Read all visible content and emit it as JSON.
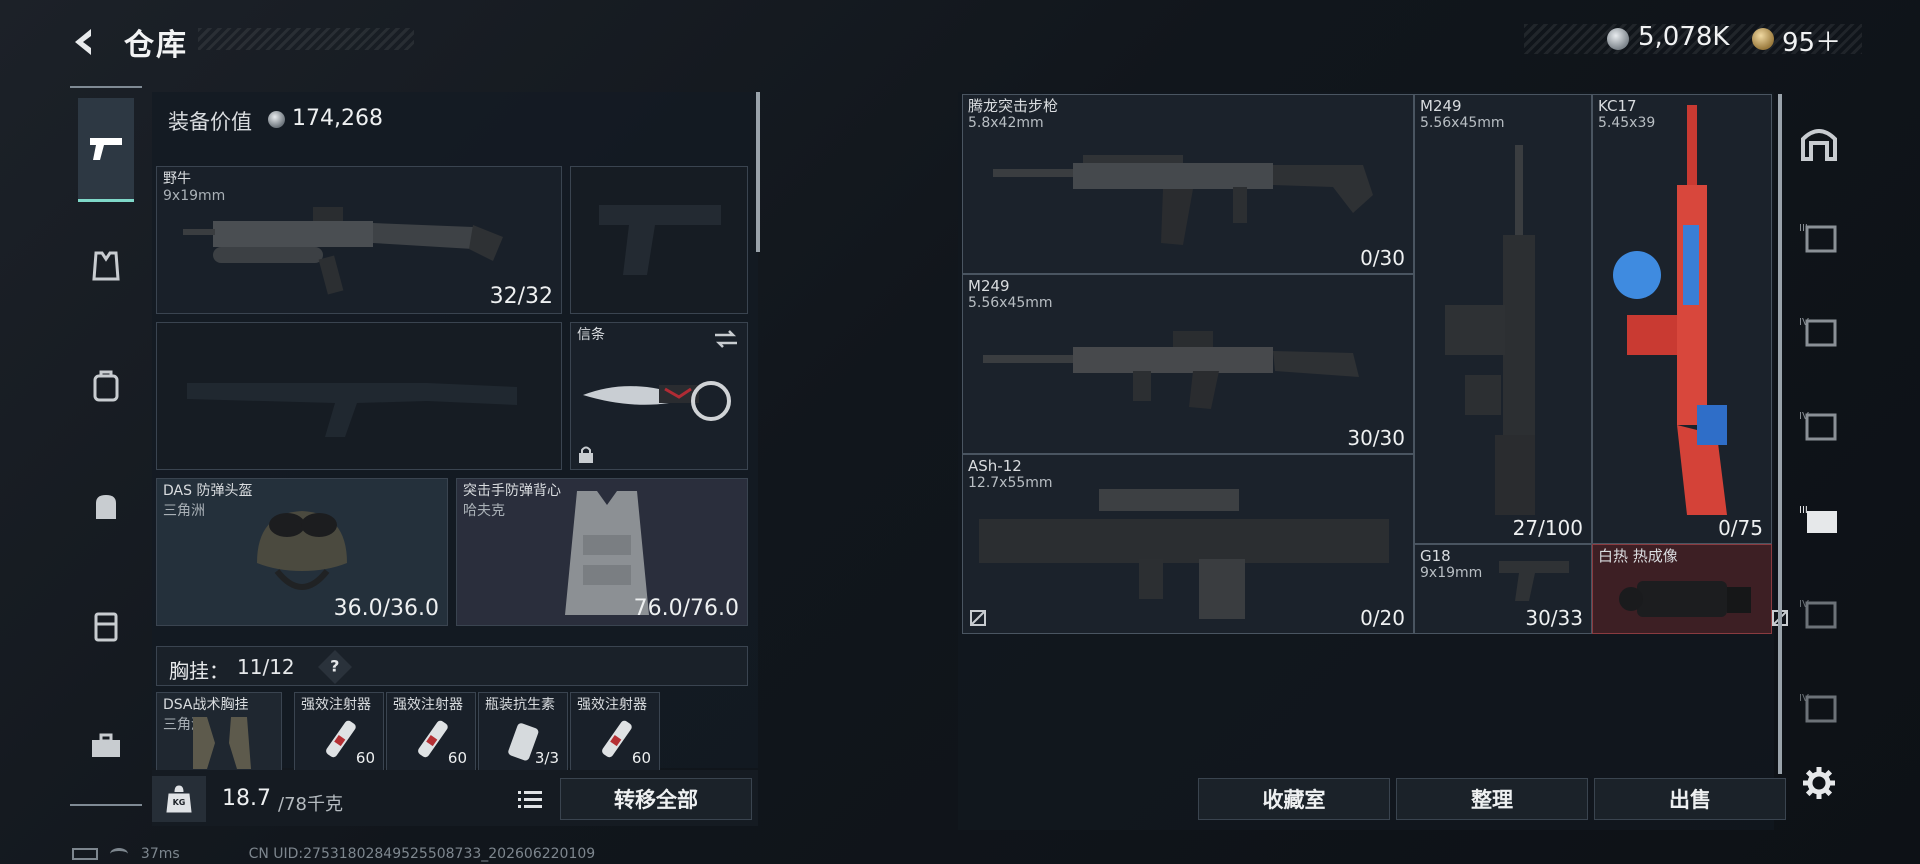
{
  "header": {
    "title": "仓库",
    "back_icon": "back-arrow-icon",
    "currency1_value": "5,078K",
    "currency2_value": "95＋",
    "currency1_icon": "silver-coin-icon",
    "currency2_icon": "gold-coin-icon"
  },
  "loadout": {
    "value_label": "装备价值",
    "value": "174,268",
    "primary": {
      "name": "野牛",
      "caliber": "9x19mm",
      "ammo": "32/32"
    },
    "melee": {
      "name": "信条"
    },
    "helmet": {
      "name": "DAS 防弹头盔",
      "faction": "三角洲",
      "durability": "36.0/36.0"
    },
    "armor": {
      "name": "突击手防弹背心",
      "faction": "哈夫克",
      "durability": "76.0/76.0"
    },
    "chest_label": "胸挂：",
    "chest_value": "11/12",
    "chest_help": "?",
    "rig": {
      "name": "DSA战术胸挂",
      "faction": "三角洲"
    },
    "rig_items": [
      {
        "name": "强效注射器",
        "count": "60"
      },
      {
        "name": "强效注射器",
        "count": "60"
      },
      {
        "name": "瓶装抗生素",
        "count": "3/3"
      },
      {
        "name": "强效注射器",
        "count": "60"
      }
    ],
    "weight": "18.7",
    "weight_max": "/78千克",
    "weight_icon_text": "KG",
    "transfer_all": "转移全部"
  },
  "stash": {
    "items": [
      {
        "name": "腾龙突击步枪",
        "caliber": "5.8x42mm",
        "count": "0/30"
      },
      {
        "name": "M249",
        "caliber": "5.56x45mm",
        "count": "30/30"
      },
      {
        "name": "ASh-12",
        "caliber": "12.7x55mm",
        "count": "0/20"
      },
      {
        "name": "M249",
        "caliber": "5.56x45mm",
        "count": "27/100"
      },
      {
        "name": "KC17",
        "caliber": "5.45x39",
        "count": "0/75"
      },
      {
        "name": "G18",
        "caliber": "9x19mm",
        "count": "30/33"
      },
      {
        "name": "白热 热成像",
        "caliber": "",
        "count": ""
      }
    ],
    "buttons": {
      "collection": "收藏室",
      "sort": "整理",
      "sell": "出售"
    }
  },
  "status": {
    "ping": "37ms",
    "uid": "CN UID:27531802849525508733_202606220109"
  },
  "colors": {
    "accent": "#7fd8c9",
    "highlight_red": "#5a2a2e"
  }
}
